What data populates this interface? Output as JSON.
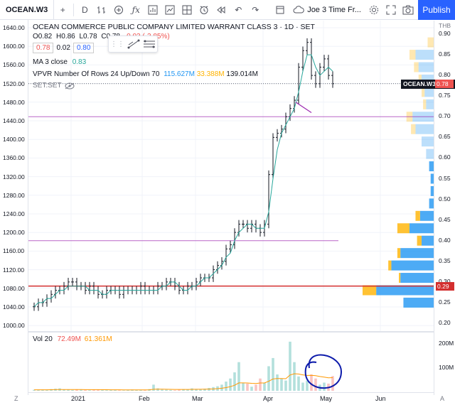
{
  "toolbar": {
    "symbol": "OCEAN.W3",
    "interval": "D",
    "layout_name": "Joe 3 Time Fr...",
    "publish": "Publish"
  },
  "legend": {
    "title": "OCEAN COMMERCE PUBLIC COMPANY LIMITED WARRANT CLASS 3 · 1D · SET",
    "ohlc": [
      "O0.82",
      "H0.86",
      "L0.78",
      "C0.78",
      "-0.03 (-3.85%)"
    ],
    "bid": "0.78",
    "spread": "0.02",
    "ask": "0.80",
    "ma_label": "MA 3 close",
    "ma_value": "0.83",
    "vpvr_label": "VPVR Number Of Rows 24 Up/Down 70",
    "vpvr_up": "115.627M",
    "vpvr_down": "33.388M",
    "vpvr_total": "139.014M",
    "setset": "SET:SET"
  },
  "vol_legend": {
    "label": "Vol 20",
    "v1": "72.49M",
    "v2": "61.361M"
  },
  "left_axis": [
    "1640.00",
    "1600.00",
    "1560.00",
    "1520.00",
    "1480.00",
    "1440.00",
    "1400.00",
    "1360.00",
    "1320.00",
    "1280.00",
    "1240.00",
    "1200.00",
    "1160.00",
    "1120.00",
    "1080.00",
    "1040.00",
    "1000.00"
  ],
  "right_axis": [
    "THB",
    "0.90",
    "0.85",
    "0.80",
    "0.75",
    "0.70",
    "0.65",
    "0.60",
    "0.55",
    "0.50",
    "0.45",
    "0.40",
    "0.35",
    "0.30",
    "0.25",
    "0.20"
  ],
  "vol_axis": [
    "200M",
    "100M"
  ],
  "price_tag": "OCEAN.W3 · 0.78",
  "red_tag": "0.29",
  "time_axis": [
    "2021",
    "Feb",
    "Mar",
    "Apr",
    "May",
    "Jun"
  ],
  "corners": {
    "left": "Z",
    "right": "A"
  },
  "colors": {
    "up": "#26a69a",
    "down": "#ef5350",
    "accent": "#2962ff",
    "ma": "#26a69a",
    "hline_purple": "#9c27b0",
    "hline_red": "#d32f2f",
    "vpvr_up": "#2196f3",
    "vpvr_down": "#ffb300"
  },
  "chart_data": {
    "type": "candlestick",
    "series_close": [
      0.24,
      0.25,
      0.25,
      0.26,
      0.27,
      0.28,
      0.28,
      0.29,
      0.3,
      0.3,
      0.29,
      0.29,
      0.28,
      0.29,
      0.28,
      0.27,
      0.27,
      0.28,
      0.28,
      0.28,
      0.27,
      0.28,
      0.28,
      0.28,
      0.28,
      0.29,
      0.28,
      0.28,
      0.28,
      0.29,
      0.29,
      0.3,
      0.3,
      0.29,
      0.28,
      0.28,
      0.29,
      0.29,
      0.3,
      0.31,
      0.31,
      0.31,
      0.33,
      0.34,
      0.35,
      0.38,
      0.39,
      0.42,
      0.44,
      0.44,
      0.43,
      0.44,
      0.43,
      0.42,
      0.44,
      0.56,
      0.65,
      0.66,
      0.67,
      0.7,
      0.72,
      0.74,
      0.82,
      0.86,
      0.88,
      0.8,
      0.78,
      0.82,
      0.84,
      0.8,
      0.78
    ],
    "ma3": [
      0.24,
      0.25,
      0.25,
      0.26,
      0.26,
      0.27,
      0.28,
      0.28,
      0.29,
      0.29,
      0.29,
      0.29,
      0.29,
      0.28,
      0.28,
      0.28,
      0.27,
      0.27,
      0.28,
      0.28,
      0.28,
      0.28,
      0.28,
      0.28,
      0.28,
      0.28,
      0.28,
      0.28,
      0.28,
      0.28,
      0.29,
      0.29,
      0.3,
      0.3,
      0.29,
      0.28,
      0.28,
      0.29,
      0.29,
      0.3,
      0.31,
      0.31,
      0.32,
      0.33,
      0.34,
      0.36,
      0.37,
      0.4,
      0.42,
      0.43,
      0.44,
      0.44,
      0.43,
      0.43,
      0.43,
      0.47,
      0.55,
      0.62,
      0.66,
      0.68,
      0.7,
      0.72,
      0.76,
      0.81,
      0.85,
      0.85,
      0.82,
      0.8,
      0.81,
      0.82,
      0.81
    ],
    "volume_millions": [
      5,
      4,
      6,
      5,
      8,
      10,
      12,
      6,
      5,
      4,
      6,
      5,
      4,
      3,
      5,
      6,
      4,
      3,
      4,
      5,
      3,
      2,
      4,
      6,
      5,
      4,
      3,
      8,
      30,
      12,
      6,
      5,
      4,
      3,
      5,
      8,
      6,
      12,
      9,
      7,
      10,
      14,
      18,
      22,
      30,
      45,
      60,
      90,
      140,
      40,
      35,
      20,
      30,
      60,
      40,
      120,
      160,
      80,
      60,
      50,
      240,
      140,
      70,
      40,
      50,
      80,
      60,
      30,
      40,
      35,
      72
    ],
    "hlines": [
      {
        "price": 0.7,
        "color": "#9c27b0"
      },
      {
        "price": 0.4,
        "color": "#9c27b0"
      },
      {
        "price": 0.29,
        "color": "#d32f2f"
      }
    ],
    "vpvr_rows": [
      {
        "price": 0.88,
        "up": 0,
        "down": 4
      },
      {
        "price": 0.85,
        "up": 12,
        "down": 4
      },
      {
        "price": 0.82,
        "up": 10,
        "down": 3
      },
      {
        "price": 0.79,
        "up": 8,
        "down": 2
      },
      {
        "price": 0.76,
        "up": 6,
        "down": 2
      },
      {
        "price": 0.73,
        "up": 5,
        "down": 2
      },
      {
        "price": 0.7,
        "up": 14,
        "down": 4
      },
      {
        "price": 0.67,
        "up": 12,
        "down": 3
      },
      {
        "price": 0.64,
        "up": 8,
        "down": 0
      },
      {
        "price": 0.61,
        "up": 5,
        "down": 0
      },
      {
        "price": 0.58,
        "up": 3,
        "down": 0
      },
      {
        "price": 0.55,
        "up": 2,
        "down": 0
      },
      {
        "price": 0.52,
        "up": 2,
        "down": 0
      },
      {
        "price": 0.49,
        "up": 3,
        "down": 0
      },
      {
        "price": 0.46,
        "up": 9,
        "down": 3
      },
      {
        "price": 0.43,
        "up": 16,
        "down": 8
      },
      {
        "price": 0.4,
        "up": 8,
        "down": 3
      },
      {
        "price": 0.37,
        "up": 22,
        "down": 2
      },
      {
        "price": 0.34,
        "up": 28,
        "down": 2
      },
      {
        "price": 0.31,
        "up": 22,
        "down": 1
      },
      {
        "price": 0.28,
        "up": 38,
        "down": 9
      },
      {
        "price": 0.25,
        "up": 20,
        "down": 0
      }
    ],
    "annotation": {
      "type": "circle",
      "color": "#0d1bab"
    }
  }
}
